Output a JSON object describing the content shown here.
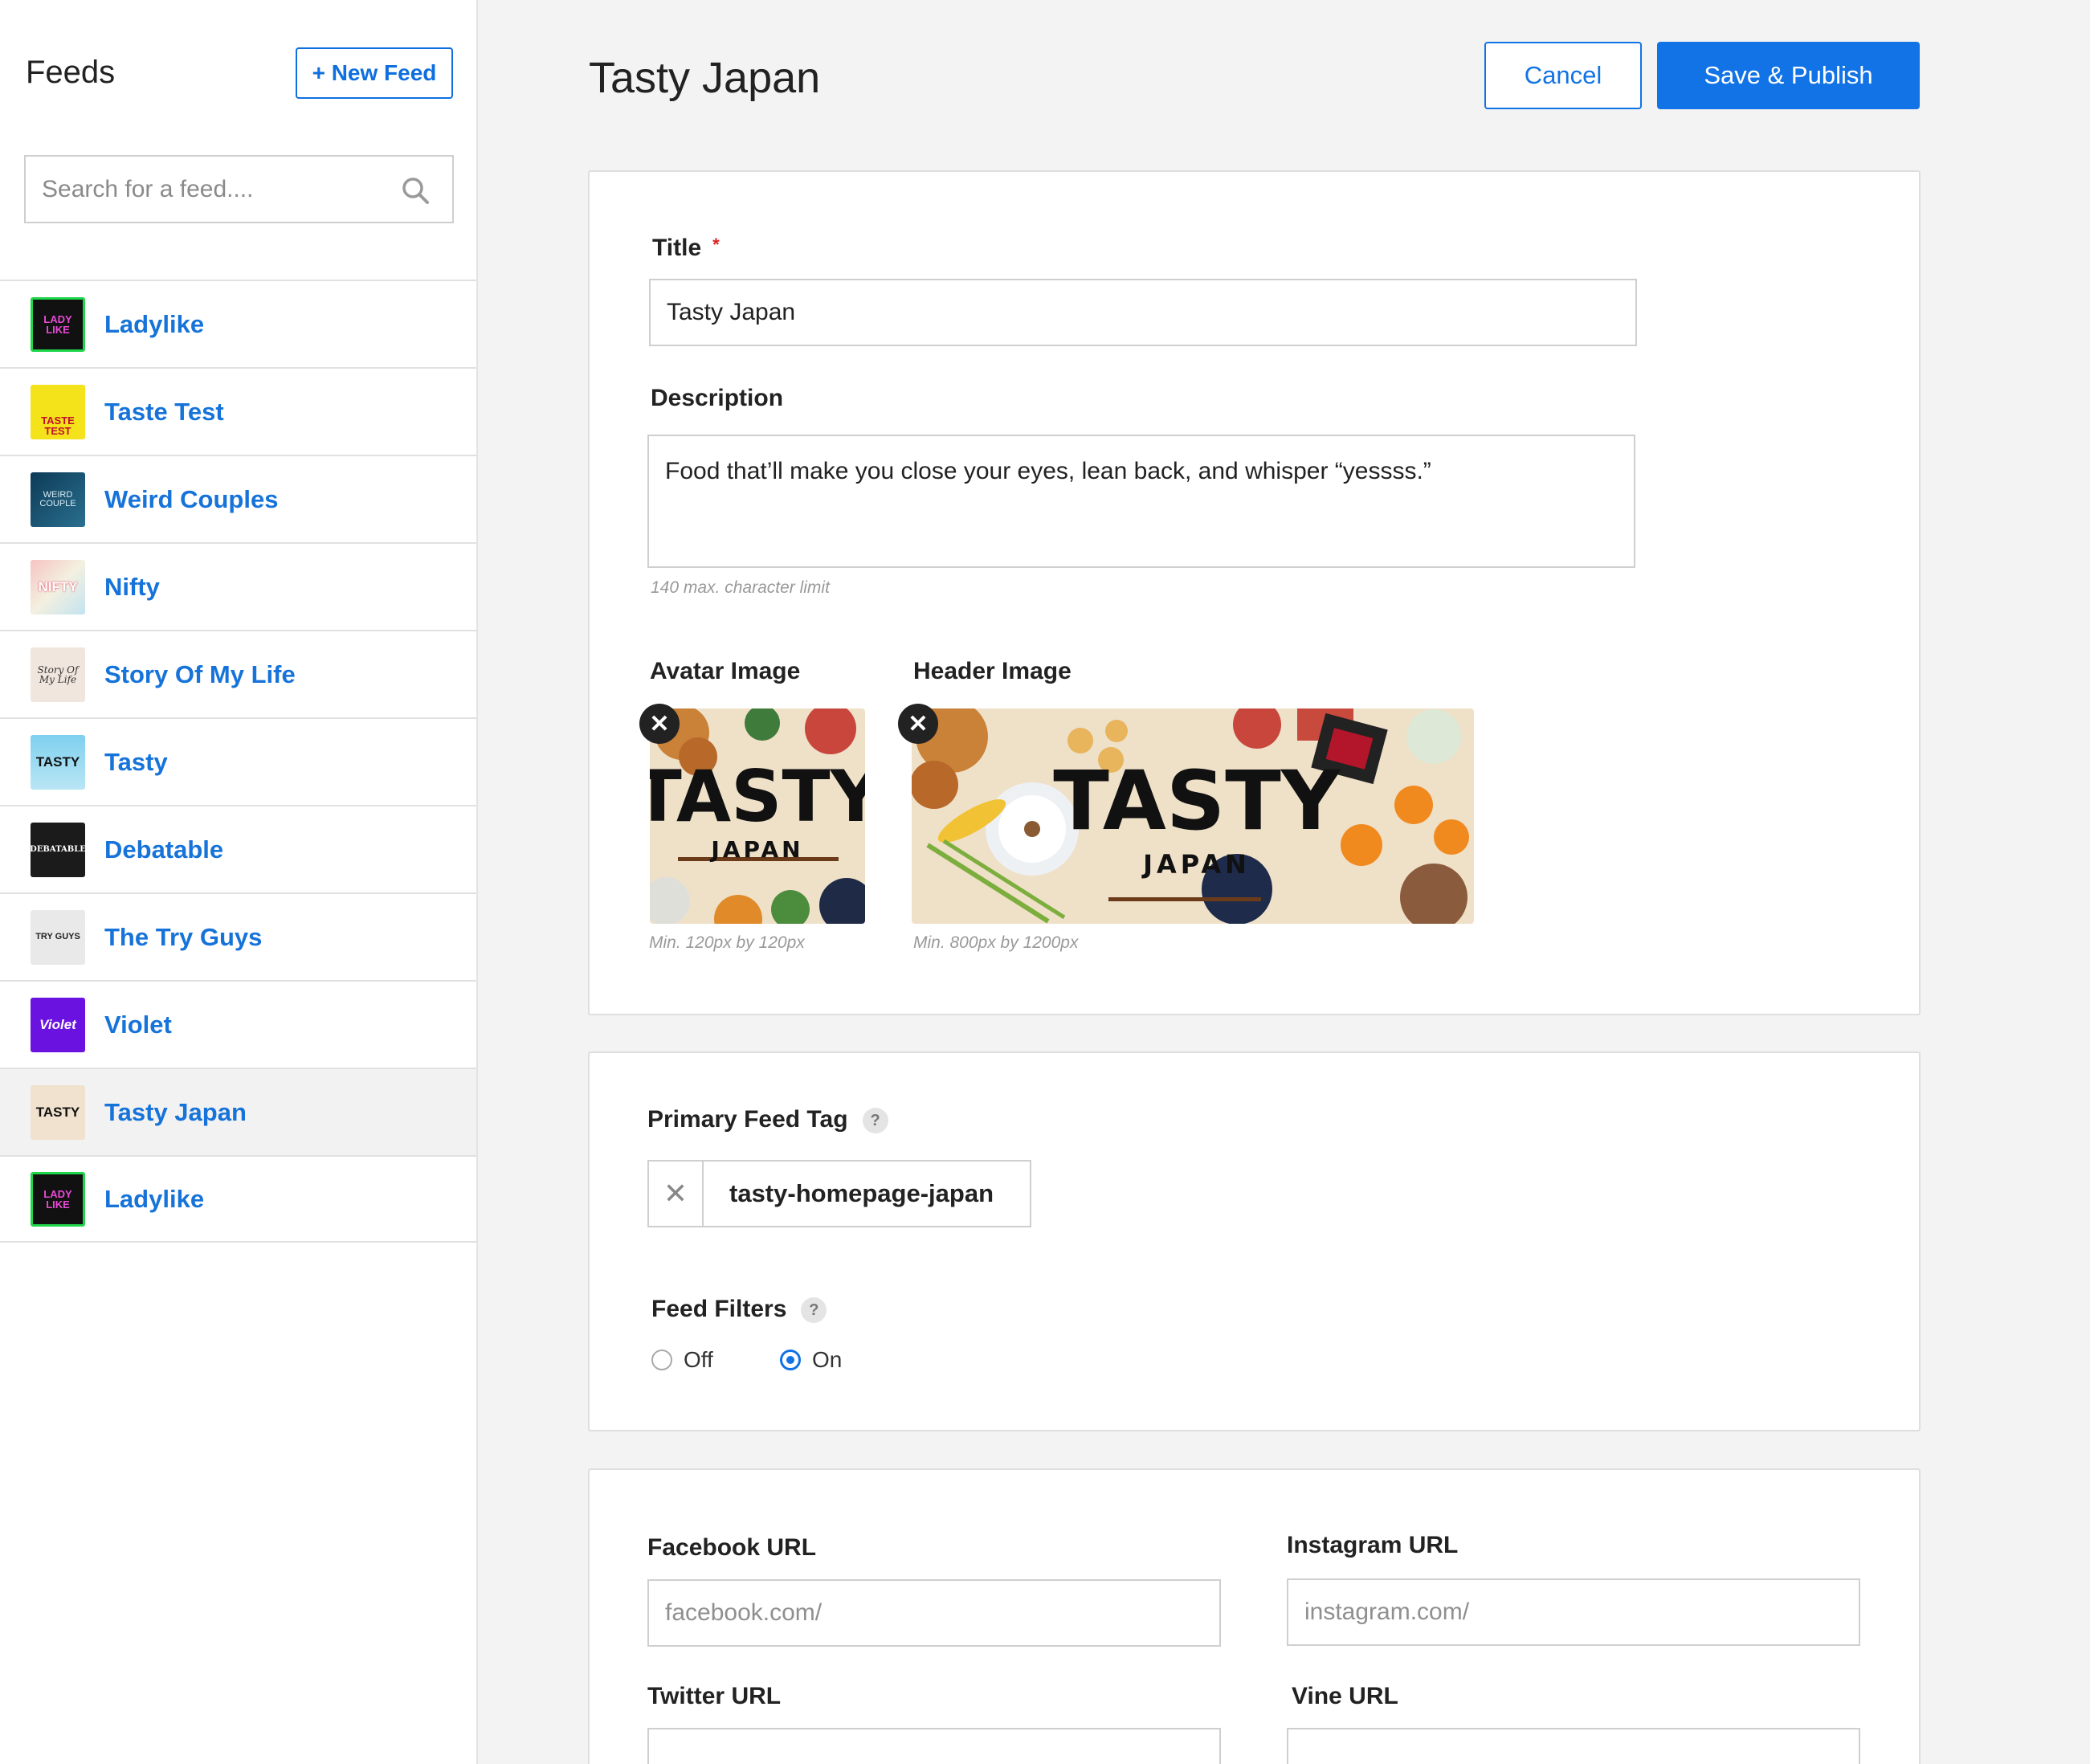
{
  "sidebar": {
    "title": "Feeds",
    "new_feed_label": "+ New Feed",
    "search_placeholder": "Search for a feed....",
    "items": [
      {
        "label": "Ladylike",
        "thumb_text": "LADY LIKE"
      },
      {
        "label": "Taste Test",
        "thumb_text": "TASTE TEST"
      },
      {
        "label": "Weird Couples",
        "thumb_text": "WEIRD COUPLE"
      },
      {
        "label": "Nifty",
        "thumb_text": "NIFTY"
      },
      {
        "label": "Story Of My Life",
        "thumb_text": "Story Of My Life"
      },
      {
        "label": "Tasty",
        "thumb_text": "TASTY"
      },
      {
        "label": "Debatable",
        "thumb_text": "DEBATABLE"
      },
      {
        "label": "The Try Guys",
        "thumb_text": "TRY GUYS"
      },
      {
        "label": "Violet",
        "thumb_text": "Violet"
      },
      {
        "label": "Tasty Japan",
        "thumb_text": "TASTY"
      },
      {
        "label": "Ladylike",
        "thumb_text": "LADY LIKE"
      }
    ],
    "active_index": 9
  },
  "header": {
    "title": "Tasty Japan",
    "cancel_label": "Cancel",
    "save_label": "Save & Publish"
  },
  "form": {
    "title_label": "Title",
    "required_mark": "*",
    "title_value": "Tasty Japan",
    "description_label": "Description",
    "description_value": "Food that’ll make you close your eyes, lean back, and whisper “yessss.”",
    "description_hint": "140 max. character limit",
    "avatar_label": "Avatar Image",
    "avatar_hint": "Min. 120px by 120px",
    "header_label": "Header Image",
    "header_hint": "Min. 800px by 1200px",
    "image_title": "TASTY",
    "image_subtitle": "JAPAN",
    "primary_tag_label": "Primary Feed Tag",
    "help_mark": "?",
    "primary_tag_value": "tasty-homepage-japan",
    "filters_label": "Feed Filters",
    "filter_off": "Off",
    "filter_on": "On",
    "filters_selected": "On",
    "facebook_label": "Facebook URL",
    "facebook_placeholder": "facebook.com/",
    "instagram_label": "Instagram URL",
    "instagram_placeholder": "instagram.com/",
    "twitter_label": "Twitter URL",
    "vine_label": "Vine URL"
  },
  "colors": {
    "accent": "#1173e6",
    "link": "#1673d9",
    "required": "#e02020"
  }
}
